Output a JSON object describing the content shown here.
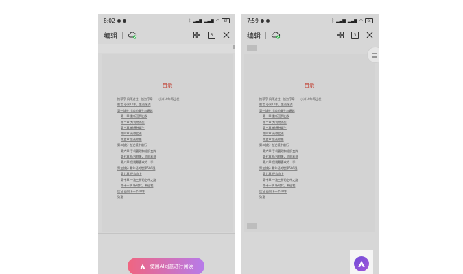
{
  "colors": {
    "toc_title": "#c0392b",
    "cloud_check": "#2fb34a",
    "ai_gradient_start": "#f06580",
    "ai_gradient_end": "#b67bea",
    "ai_float": "#7a4fdb"
  },
  "phones": [
    {
      "status": {
        "time": "8:02",
        "battery": "67"
      },
      "toolbar": {
        "edit_label": "编辑",
        "page_count": "3"
      },
      "ai_button_label": "使用AI同意进行阅读"
    },
    {
      "status": {
        "time": "7:59",
        "battery": "66"
      },
      "toolbar": {
        "edit_label": "编辑",
        "page_count": "3"
      }
    }
  ],
  "document": {
    "toc_title": "目录",
    "toc": [
      {
        "text": "推荐序 风雨过往，皆为序章——小米10年再出发",
        "level": 0
      },
      {
        "text": "前言 小米10年，生而滚烫",
        "level": 0
      },
      {
        "text": "第一部分 小米的诞生与崛起",
        "level": 0
      },
      {
        "text": "第一章 重新回到出发",
        "level": 1
      },
      {
        "text": "第二章 为发烧而生",
        "level": 1
      },
      {
        "text": "第三章 新想种诞生",
        "level": 1
      },
      {
        "text": "第四章 高歌猛进",
        "level": 1
      },
      {
        "text": "第五章 生死较量",
        "level": 1
      },
      {
        "text": "第二部分 在逆境中前行",
        "level": 0
      },
      {
        "text": "第六章 手机管理和组织变阵",
        "level": 1
      },
      {
        "text": "第七章 低谷到来，危机初现",
        "level": 1
      },
      {
        "text": "第八章 但我最喜欢的一季",
        "level": 1
      },
      {
        "text": "第三部分 最年轻的世界500强",
        "level": 0
      },
      {
        "text": "第九章 逆势向上",
        "level": 1
      },
      {
        "text": "第十章 一波三折的上市之路",
        "level": 1
      },
      {
        "text": "第十一章 新时代，新征程",
        "level": 1
      },
      {
        "text": "后记 迈向下一个10年",
        "level": 0
      },
      {
        "text": "致谢",
        "level": 0
      }
    ]
  }
}
